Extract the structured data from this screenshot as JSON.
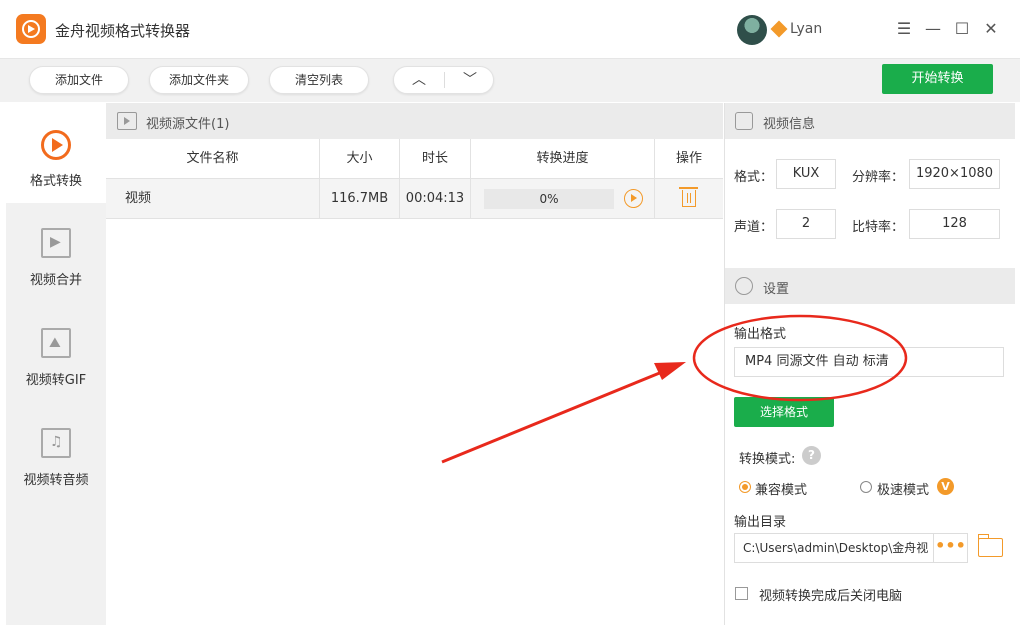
{
  "app": {
    "title": "金舟视频格式转换器"
  },
  "user": {
    "name": "Lyan"
  },
  "window_controls": {
    "menu": "☰",
    "minimize": "—",
    "maximize": "☐",
    "close": "✕"
  },
  "toolbar": {
    "add_file": "添加文件",
    "add_folder": "添加文件夹",
    "clear_list": "清空列表",
    "move_up": "︿",
    "move_down": "﹀",
    "start": "开始转换"
  },
  "sidebar": {
    "items": [
      {
        "label": "格式转换",
        "active": true
      },
      {
        "label": "视频合并"
      },
      {
        "label": "视频转GIF"
      },
      {
        "label": "视频转音频"
      }
    ]
  },
  "file_panel": {
    "header": "视频源文件(1)",
    "columns": [
      "文件名称",
      "大小",
      "时长",
      "转换进度",
      "操作"
    ],
    "rows": [
      {
        "name": "视频",
        "size": "116.7MB",
        "duration": "00:04:13",
        "progress": "0%"
      }
    ]
  },
  "video_info": {
    "header": "视频信息",
    "format_label": "格式：",
    "format": "KUX",
    "resolution_label": "分辨率：",
    "resolution": "1920×1080",
    "channel_label": "声道：",
    "channel": "2",
    "bitrate_label": "比特率：",
    "bitrate": "128"
  },
  "settings": {
    "header": "设置",
    "output_format_label": "输出格式",
    "output_format": "MP4 同源文件 自动 标清",
    "select_format": "选择格式",
    "mode_label": "转换模式:",
    "help": "?",
    "mode_compat": "兼容模式",
    "mode_fast": "极速模式",
    "vip_badge": "V",
    "output_dir_label": "输出目录",
    "output_dir": "C:\\Users\\admin\\Desktop\\金舟视",
    "browse": "•••",
    "shutdown_label": "视频转换完成后关闭电脑"
  },
  "colors": {
    "accent": "#1aad4b",
    "orange": "#f39a2a",
    "brand": "#f47a20",
    "annotation": "#e8291c"
  }
}
